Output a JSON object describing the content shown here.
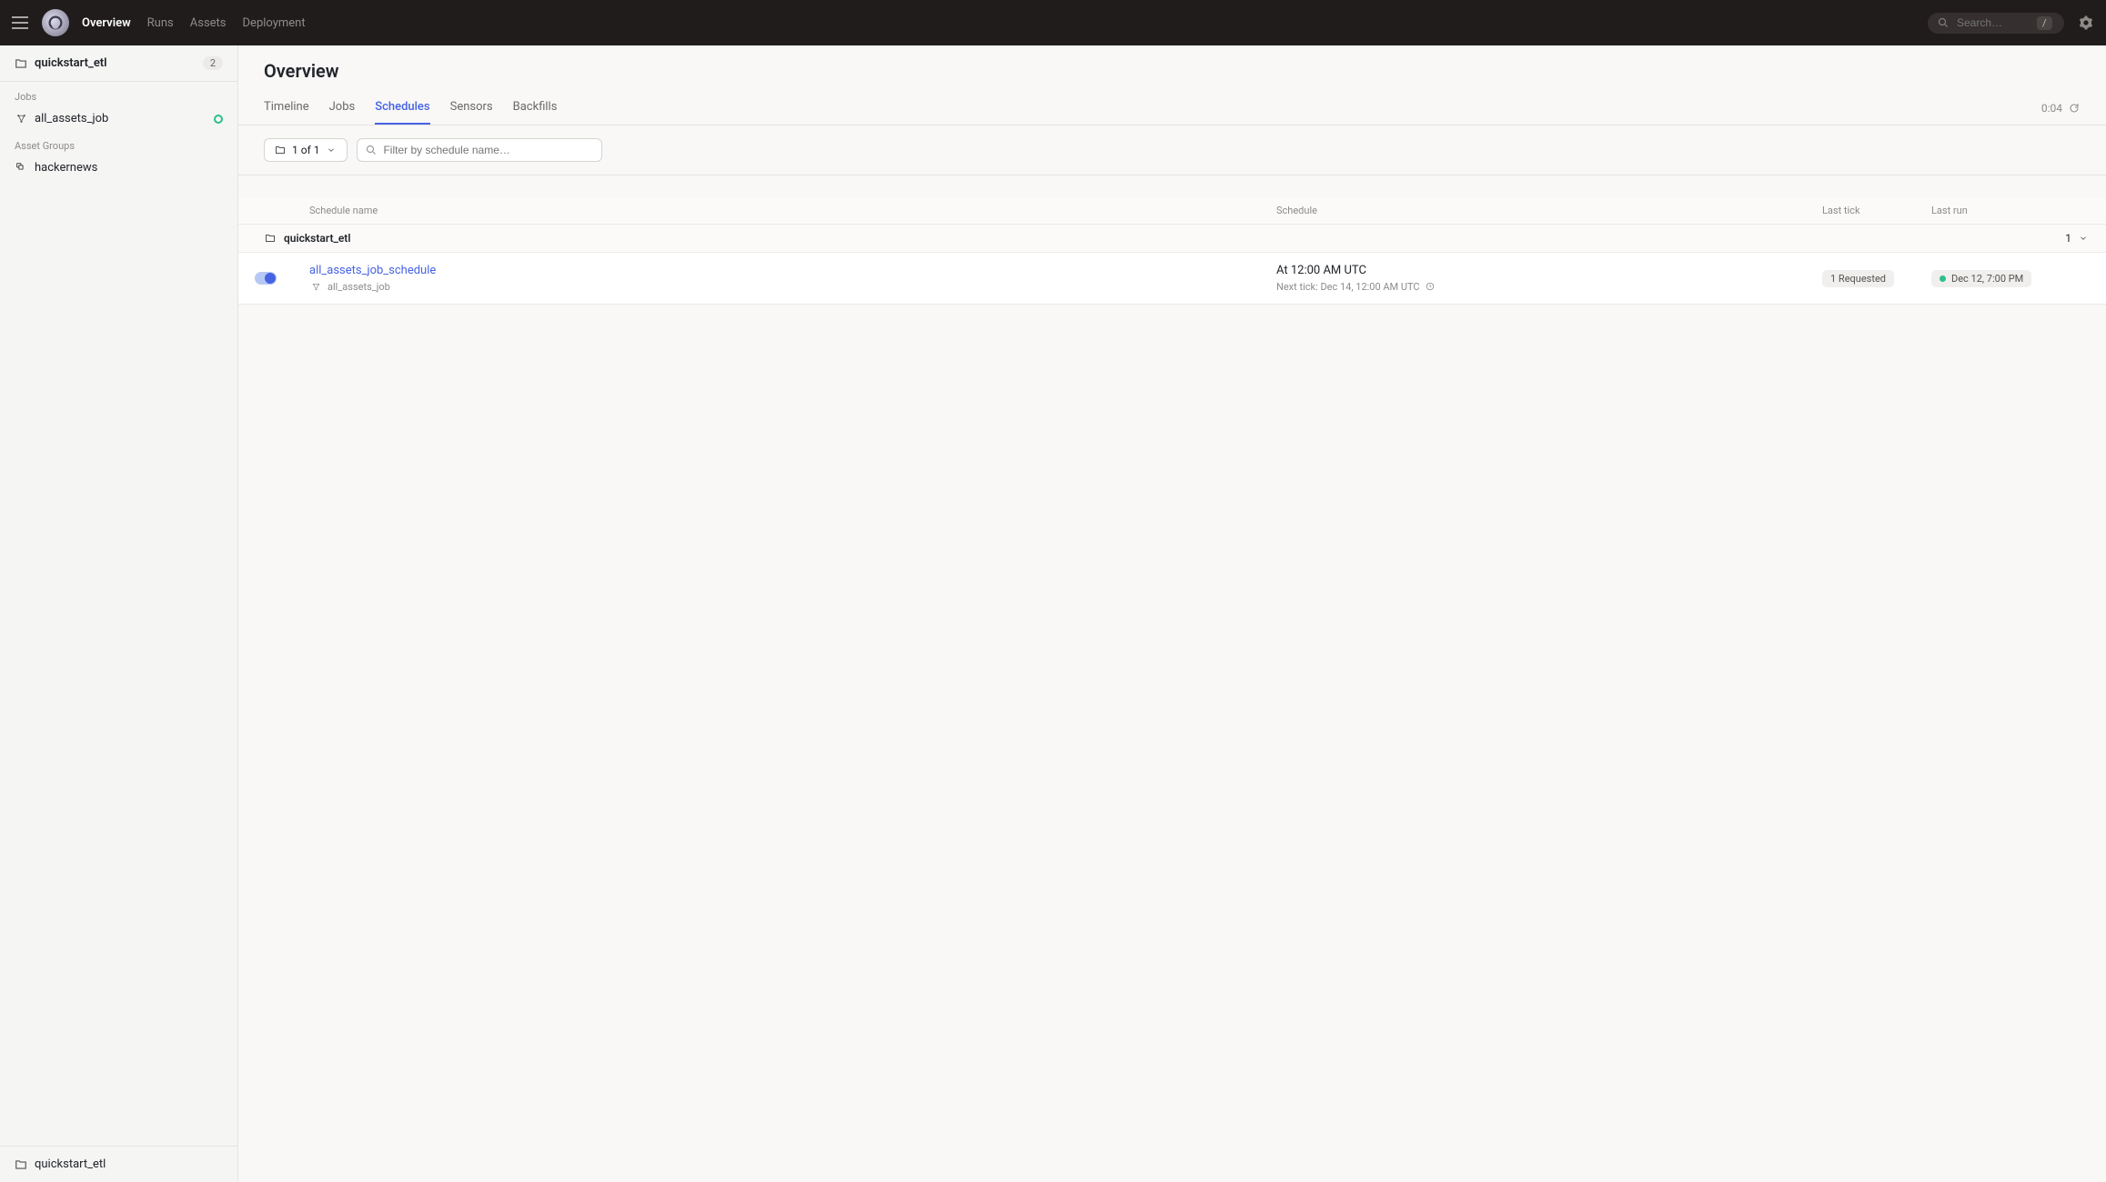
{
  "header": {
    "nav": [
      {
        "label": "Overview",
        "active": true
      },
      {
        "label": "Runs"
      },
      {
        "label": "Assets"
      },
      {
        "label": "Deployment"
      }
    ],
    "search_placeholder": "Search…",
    "search_shortcut": "/"
  },
  "sidebar": {
    "repo_name": "quickstart_etl",
    "repo_count": "2",
    "sections": [
      {
        "label": "Jobs",
        "items": [
          {
            "name": "all_assets_job",
            "icon": "job",
            "status": "ok"
          }
        ]
      },
      {
        "label": "Asset Groups",
        "items": [
          {
            "name": "hackernews",
            "icon": "assetgroup"
          }
        ]
      }
    ],
    "bottom_repo": "quickstart_etl"
  },
  "page": {
    "title": "Overview",
    "tabs": [
      {
        "label": "Timeline"
      },
      {
        "label": "Jobs"
      },
      {
        "label": "Schedules",
        "active": true
      },
      {
        "label": "Sensors"
      },
      {
        "label": "Backfills"
      }
    ],
    "refresh_timer": "0:04"
  },
  "toolbar": {
    "repo_selector": "1 of 1",
    "filter_placeholder": "Filter by schedule name…"
  },
  "table": {
    "columns": {
      "name": "Schedule name",
      "schedule": "Schedule",
      "last_tick": "Last tick",
      "last_run": "Last run"
    },
    "group": {
      "name": "quickstart_etl",
      "count": "1"
    },
    "rows": [
      {
        "enabled": true,
        "name": "all_assets_job_schedule",
        "job": "all_assets_job",
        "schedule_text": "At 12:00 AM UTC",
        "next_tick": "Next tick: Dec 14, 12:00 AM UTC",
        "last_tick": "1 Requested",
        "last_run": "Dec 12, 7:00 PM"
      }
    ]
  }
}
